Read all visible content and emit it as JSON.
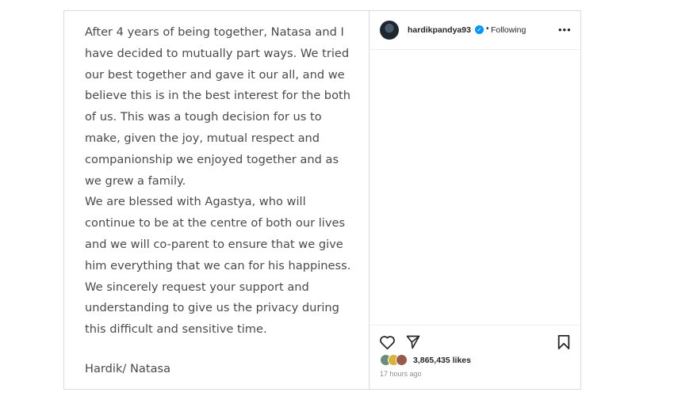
{
  "statement": {
    "paragraph1": "After 4 years of being together, Natasa and I\nhave decided to mutually part ways. We tried\nour best together and gave it our all, and we\nbelieve this is in the best interest for the both\nof us. This was a tough decision for us to\nmake, given the joy, mutual respect and\ncompanionship we enjoyed together and as\nwe grew a family.",
    "paragraph2": "We are blessed with Agastya, who will\ncontinue to be at the centre of both our lives\nand we will co-parent to ensure that we give\nhim everything that we can for his happiness.\nWe sincerely request your support and\nunderstanding to give us the privacy during\nthis difficult and sensitive time.",
    "signature": "Hardik/ Natasa"
  },
  "header": {
    "username": "hardikpandya93",
    "separator": "•",
    "following": "Following",
    "more_icon": "more-horizontal-icon",
    "verified_icon": "verified-badge-icon"
  },
  "actions": {
    "like_icon": "heart-outline-icon",
    "share_icon": "paper-plane-icon",
    "save_icon": "bookmark-outline-icon"
  },
  "likes": {
    "count_text": "3,865,435 likes"
  },
  "timestamp": "17 hours ago",
  "colors": {
    "border": "#dbdbdb",
    "text": "#262626",
    "muted": "#8e8e8e",
    "verified": "#0095f6",
    "statement_text": "#4a4a4a"
  }
}
